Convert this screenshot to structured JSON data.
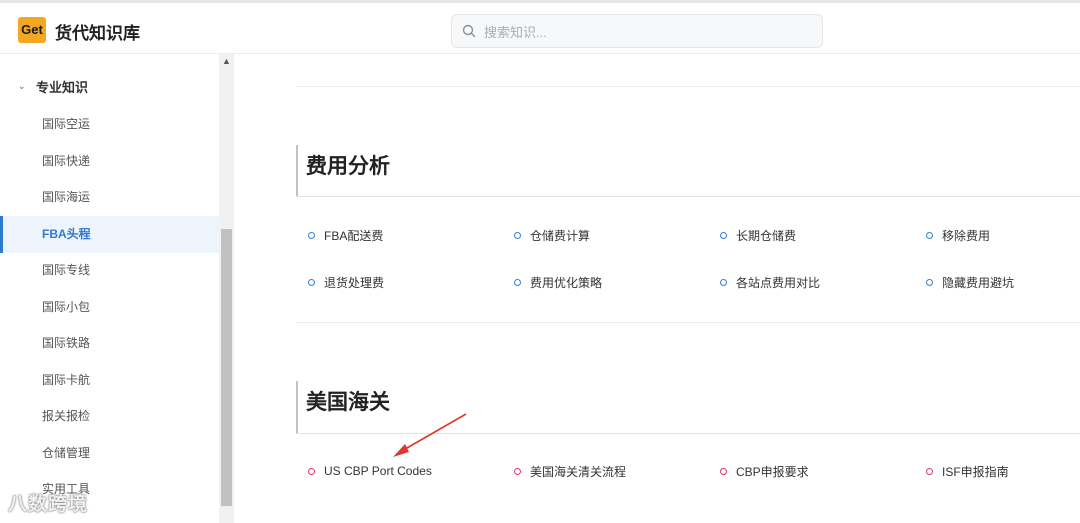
{
  "header": {
    "logo_text": "Get",
    "app_title": "货代知识库",
    "search_placeholder": "搜索知识..."
  },
  "sidebar": {
    "section_label": "专业知识",
    "items": [
      {
        "label": "国际空运"
      },
      {
        "label": "国际快递"
      },
      {
        "label": "国际海运"
      },
      {
        "label": "FBA头程",
        "active": true
      },
      {
        "label": "国际专线"
      },
      {
        "label": "国际小包"
      },
      {
        "label": "国际铁路"
      },
      {
        "label": "国际卡航"
      },
      {
        "label": "报关报检"
      },
      {
        "label": "仓储管理"
      },
      {
        "label": "实用工具"
      }
    ]
  },
  "main": {
    "sections": [
      {
        "title": "费用分析",
        "links": [
          "FBA配送费",
          "仓储费计算",
          "长期仓储费",
          "移除费用",
          "退货处理费",
          "费用优化策略",
          "各站点费用对比",
          "隐藏费用避坑"
        ]
      },
      {
        "title": "美国海关",
        "links": [
          "US CBP Port Codes",
          "美国海关清关流程",
          "CBP申报要求",
          "ISF申报指南"
        ]
      }
    ]
  },
  "watermark": "八数跨境",
  "colors": {
    "accent": "#2f7ad1",
    "logo_bg": "#f5a623",
    "pink_dot": "#d63a7a",
    "annotation_arrow": "#e0392b"
  }
}
